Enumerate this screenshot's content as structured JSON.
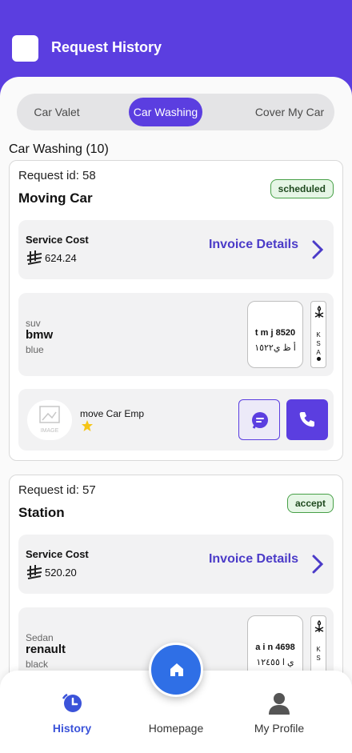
{
  "header": {
    "title": "Request History"
  },
  "tabs": [
    {
      "label": "Car Valet",
      "active": false
    },
    {
      "label": "Car Washing",
      "active": true
    },
    {
      "label": "Cover My Car",
      "active": false
    }
  ],
  "section": {
    "title": "Car Washing (10)"
  },
  "colors": {
    "primary": "#5b3ee0",
    "status_bg": "#e6f6e6",
    "status_border": "#47a047",
    "invoice": "#4b3bc8",
    "fab": "#2f6fe6",
    "star": "#f5c518"
  },
  "requests": [
    {
      "id_label": "Request id: 58",
      "name": "Moving Car",
      "status": "scheduled",
      "cost_label": "Service Cost",
      "cost_value": "624.24",
      "invoice_label": "Invoice Details",
      "car": {
        "type": "suv",
        "model": "bmw",
        "color": "blue"
      },
      "plate": {
        "en": "t m j 8520",
        "ar": "أ ظ ي١٥٢٢",
        "country": "KSA"
      },
      "employee": {
        "name": "move Car Emp",
        "avatar_text": "IMAGE"
      }
    },
    {
      "id_label": "Request id: 57",
      "name": "Station",
      "status": "accept",
      "cost_label": "Service Cost",
      "cost_value": "520.20",
      "invoice_label": "Invoice Details",
      "car": {
        "type": "Sedan",
        "model": "renault",
        "color": "black"
      },
      "plate": {
        "en": "a i n 4698",
        "ar": "ي ا ١٢٤٥٥",
        "country": "KS"
      }
    }
  ],
  "nav": {
    "history": "History",
    "homepage": "Homepage",
    "profile": "My Profile"
  }
}
